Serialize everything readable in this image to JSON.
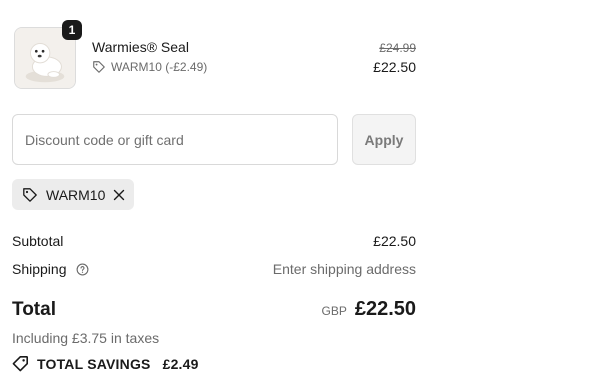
{
  "product": {
    "quantity": "1",
    "name": "Warmies® Seal",
    "discount_label": "WARM10 (-£2.49)",
    "original_price": "£24.99",
    "price": "£22.50",
    "image_icon": "plush-seal-image"
  },
  "discount": {
    "placeholder": "Discount code or gift card",
    "value": "",
    "apply_label": "Apply"
  },
  "applied_code": {
    "code": "WARM10",
    "tag_icon": "tag-icon",
    "remove_icon": "close-icon"
  },
  "totals": {
    "subtotal_label": "Subtotal",
    "subtotal_value": "£22.50",
    "shipping_label": "Shipping",
    "shipping_value": "Enter shipping address",
    "total_label": "Total",
    "currency": "GBP",
    "total_value": "£22.50",
    "taxes_note": "Including £3.75 in taxes",
    "savings_label": "TOTAL SAVINGS",
    "savings_value": "£2.49"
  },
  "colors": {
    "text": "#1a1a1a",
    "muted": "#6b6b6b",
    "chip_bg": "#ececec",
    "button_bg": "#f4f4f4",
    "badge_bg": "#1a1a1a"
  }
}
